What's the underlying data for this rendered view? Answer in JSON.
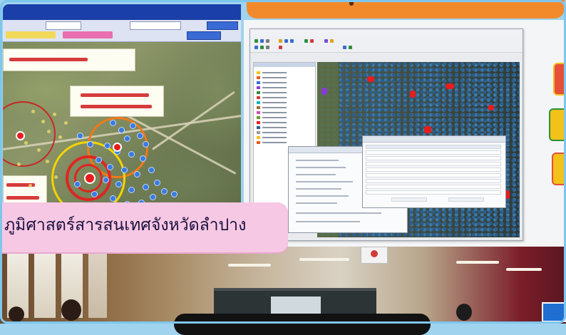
{
  "banner": {
    "text": "ภูมิศาสตร์สารสนเทศจังหวัดลำปาง"
  },
  "colors": {
    "banner_bg": "#f7c8e3",
    "orange_header": "#f28a2c",
    "frame_blue": "#7fc6ec",
    "map_titlebar": "#1b3fa8",
    "risk_red": "#e81c1c",
    "buffer_yellow": "#f2d400",
    "buffer_orange": "#f07a1a",
    "building_blue": "#3b7be0"
  },
  "icons": {
    "incident": "red-pin-icon",
    "house": "blue-dot-icon"
  }
}
